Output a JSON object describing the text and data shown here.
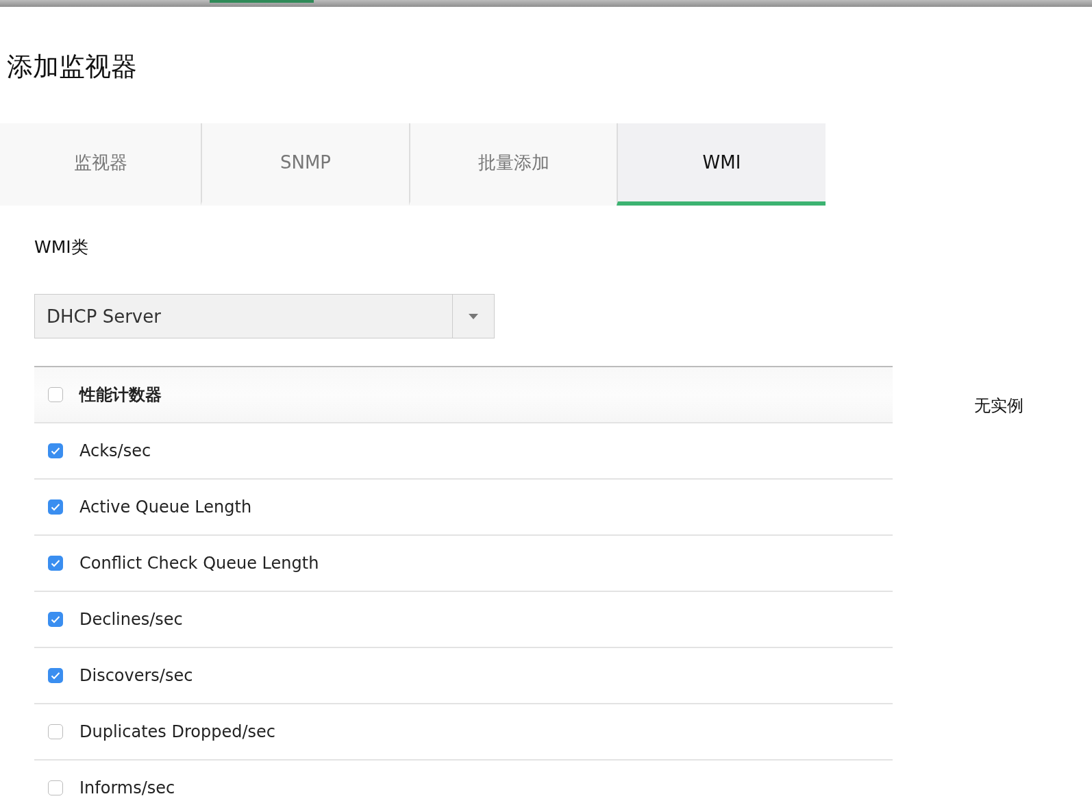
{
  "title": "添加监视器",
  "tabs": [
    {
      "label": "监视器",
      "selected": false
    },
    {
      "label": "SNMP",
      "selected": false
    },
    {
      "label": "批量添加",
      "selected": false
    },
    {
      "label": "WMI",
      "selected": true
    }
  ],
  "wmi_class": {
    "label": "WMI类",
    "value": "DHCP Server"
  },
  "counters": {
    "header": {
      "label": "性能计数器",
      "checked": false
    },
    "rows": [
      {
        "label": "Acks/sec",
        "checked": true
      },
      {
        "label": "Active Queue Length",
        "checked": true
      },
      {
        "label": "Conflict Check Queue Length",
        "checked": true
      },
      {
        "label": "Declines/sec",
        "checked": true
      },
      {
        "label": "Discovers/sec",
        "checked": true
      },
      {
        "label": "Duplicates Dropped/sec",
        "checked": false
      },
      {
        "label": "Informs/sec",
        "checked": false
      }
    ]
  },
  "instances_note": "无实例"
}
